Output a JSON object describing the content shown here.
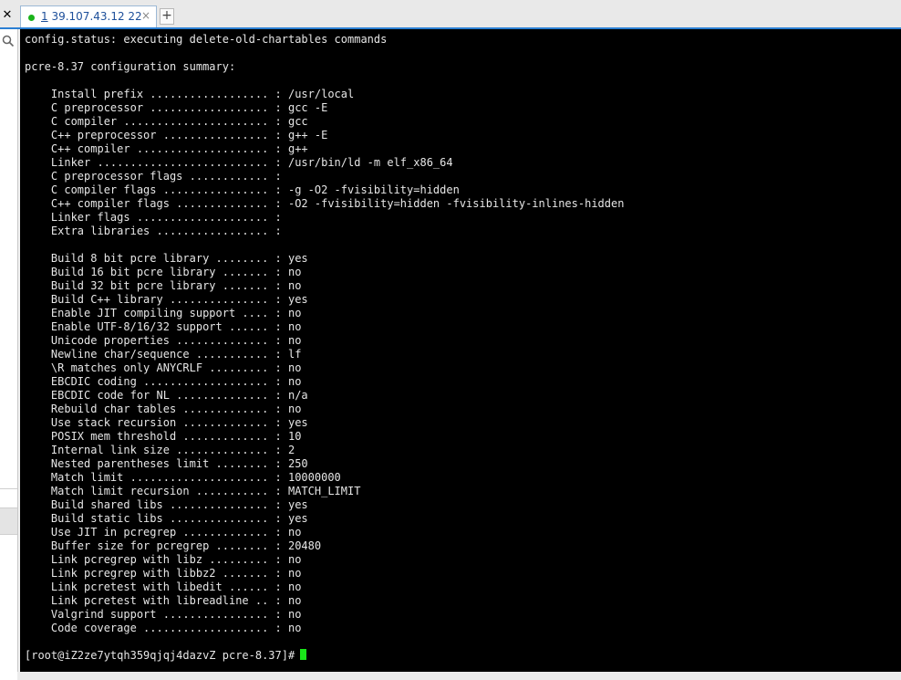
{
  "window": {
    "close_glyph": "✕"
  },
  "tabs": [
    {
      "number": "1",
      "label": " 39.107.43.12 22",
      "close_glyph": "×",
      "active": true,
      "status_color": "#1ab31a"
    }
  ],
  "new_tab_glyph": "+",
  "terminal": {
    "lines": [
      "config.status: executing delete-old-chartables commands",
      "",
      "pcre-8.37 configuration summary:",
      "",
      "    Install prefix .................. : /usr/local",
      "    C preprocessor .................. : gcc -E",
      "    C compiler ...................... : gcc",
      "    C++ preprocessor ................ : g++ -E",
      "    C++ compiler .................... : g++",
      "    Linker .......................... : /usr/bin/ld -m elf_x86_64",
      "    C preprocessor flags ............ : ",
      "    C compiler flags ................ : -g -O2 -fvisibility=hidden",
      "    C++ compiler flags .............. : -O2 -fvisibility=hidden -fvisibility-inlines-hidden",
      "    Linker flags .................... : ",
      "    Extra libraries ................. : ",
      "",
      "    Build 8 bit pcre library ........ : yes",
      "    Build 16 bit pcre library ....... : no",
      "    Build 32 bit pcre library ....... : no",
      "    Build C++ library ............... : yes",
      "    Enable JIT compiling support .... : no",
      "    Enable UTF-8/16/32 support ...... : no",
      "    Unicode properties .............. : no",
      "    Newline char/sequence ........... : lf",
      "    \\R matches only ANYCRLF ......... : no",
      "    EBCDIC coding ................... : no",
      "    EBCDIC code for NL .............. : n/a",
      "    Rebuild char tables ............. : no",
      "    Use stack recursion ............. : yes",
      "    POSIX mem threshold ............. : 10",
      "    Internal link size .............. : 2",
      "    Nested parentheses limit ........ : 250",
      "    Match limit ..................... : 10000000",
      "    Match limit recursion ........... : MATCH_LIMIT",
      "    Build shared libs ............... : yes",
      "    Build static libs ............... : yes",
      "    Use JIT in pcregrep ............. : no",
      "    Buffer size for pcregrep ........ : 20480",
      "    Link pcregrep with libz ......... : no",
      "    Link pcregrep with libbz2 ....... : no",
      "    Link pcretest with libedit ...... : no",
      "    Link pcretest with libreadline .. : no",
      "    Valgrind support ................ : no",
      "    Code coverage ................... : no",
      ""
    ],
    "prompt": "[root@iZ2ze7ytqh359qjqj4dazvZ pcre-8.37]#",
    "cursor_color": "#19e619"
  },
  "colors": {
    "terminal_bg": "#000000",
    "terminal_fg": "#e6e6e6",
    "tab_accent": "#2b7fd3"
  }
}
